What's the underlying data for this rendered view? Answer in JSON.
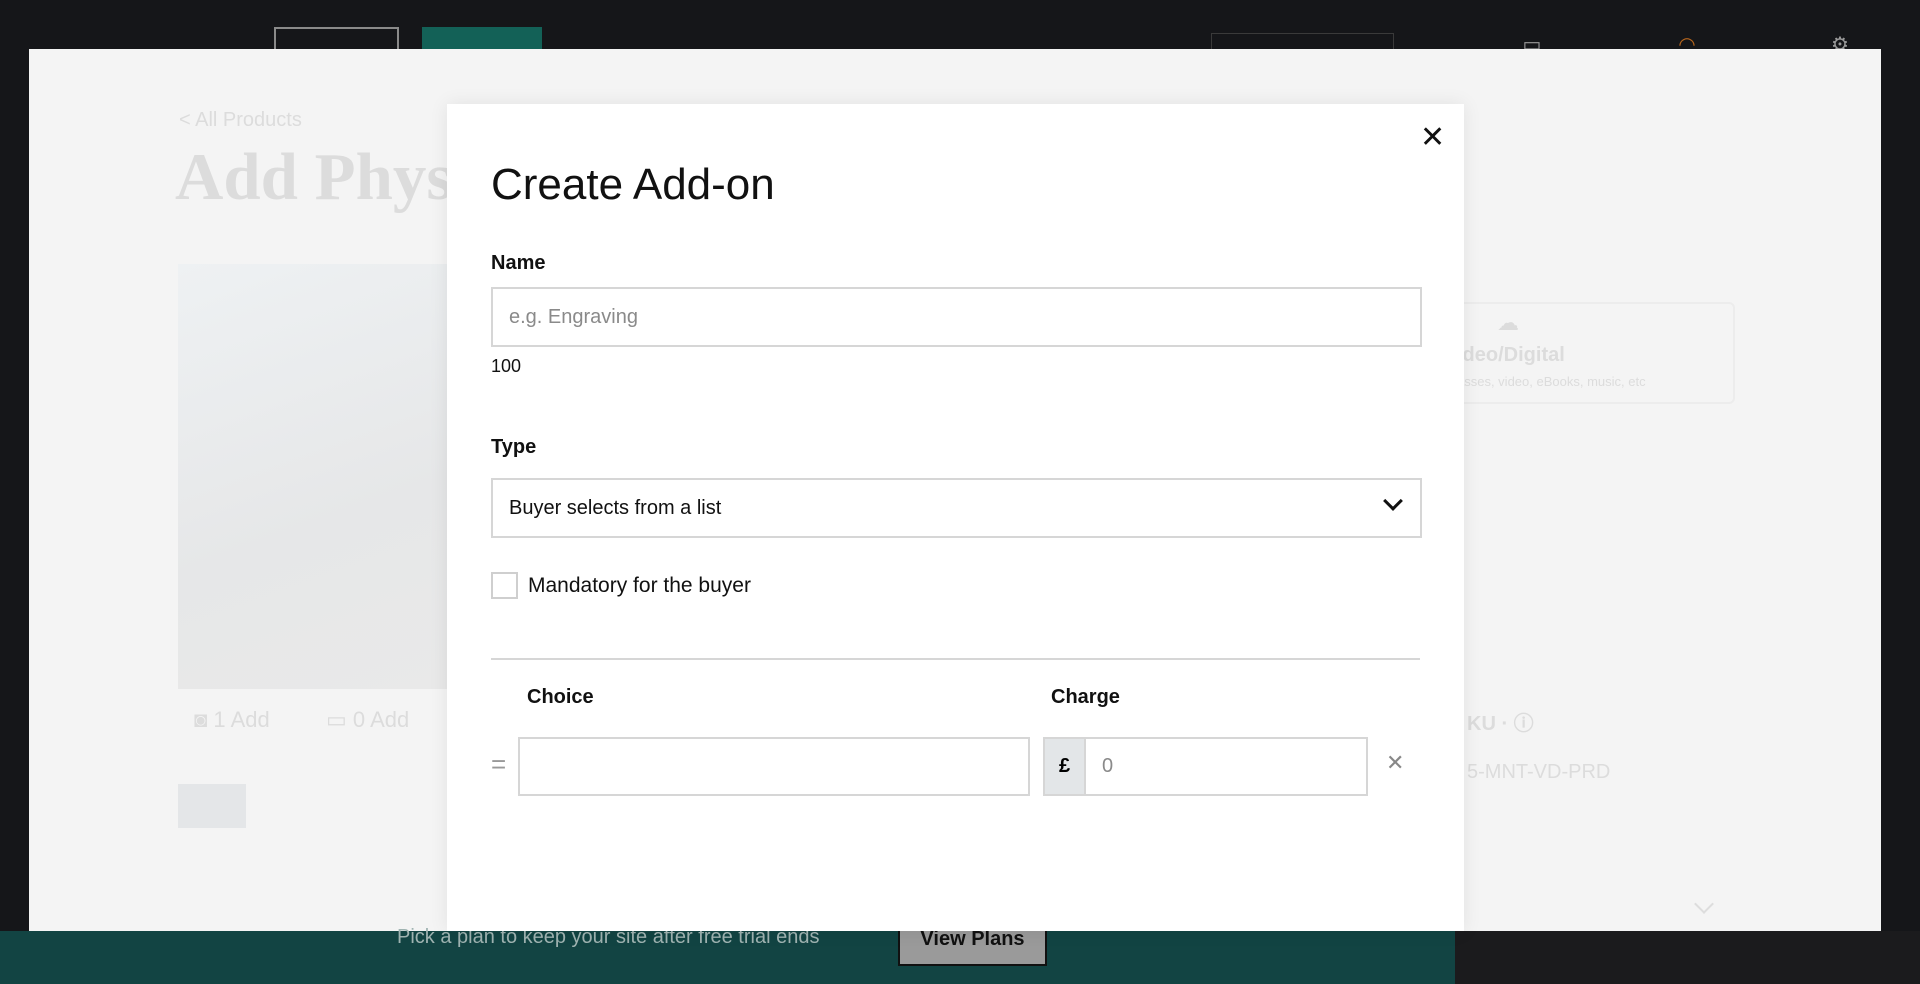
{
  "colors": {
    "accent": "#136157",
    "banner": "#124443",
    "background": "#151619"
  },
  "background_page": {
    "back_link": "< All Products",
    "title": "Add Phys",
    "photo_count": "1",
    "photo_add": "Add",
    "video_count": "0",
    "video_add": "Add",
    "type_card_title": "ideo/Digital",
    "type_card_sub": "asses, video, eBooks, music, etc",
    "sku_label": "KU",
    "sku_value": "5-MNT-VD-PRD"
  },
  "banner": {
    "text": "Pick a plan to keep your site after free trial ends",
    "button": "View Plans"
  },
  "modal": {
    "title": "Create Add-on",
    "close_icon": "close-icon",
    "name_label": "Name",
    "name_placeholder": "e.g. Engraving",
    "name_counter": "100",
    "type_label": "Type",
    "type_value": "Buyer selects from a list",
    "mandatory_label": "Mandatory for the buyer",
    "mandatory_checked": false,
    "choice_header": "Choice",
    "charge_header": "Charge",
    "choices": [
      {
        "choice": "",
        "currency": "£",
        "charge_placeholder": "0"
      }
    ]
  }
}
